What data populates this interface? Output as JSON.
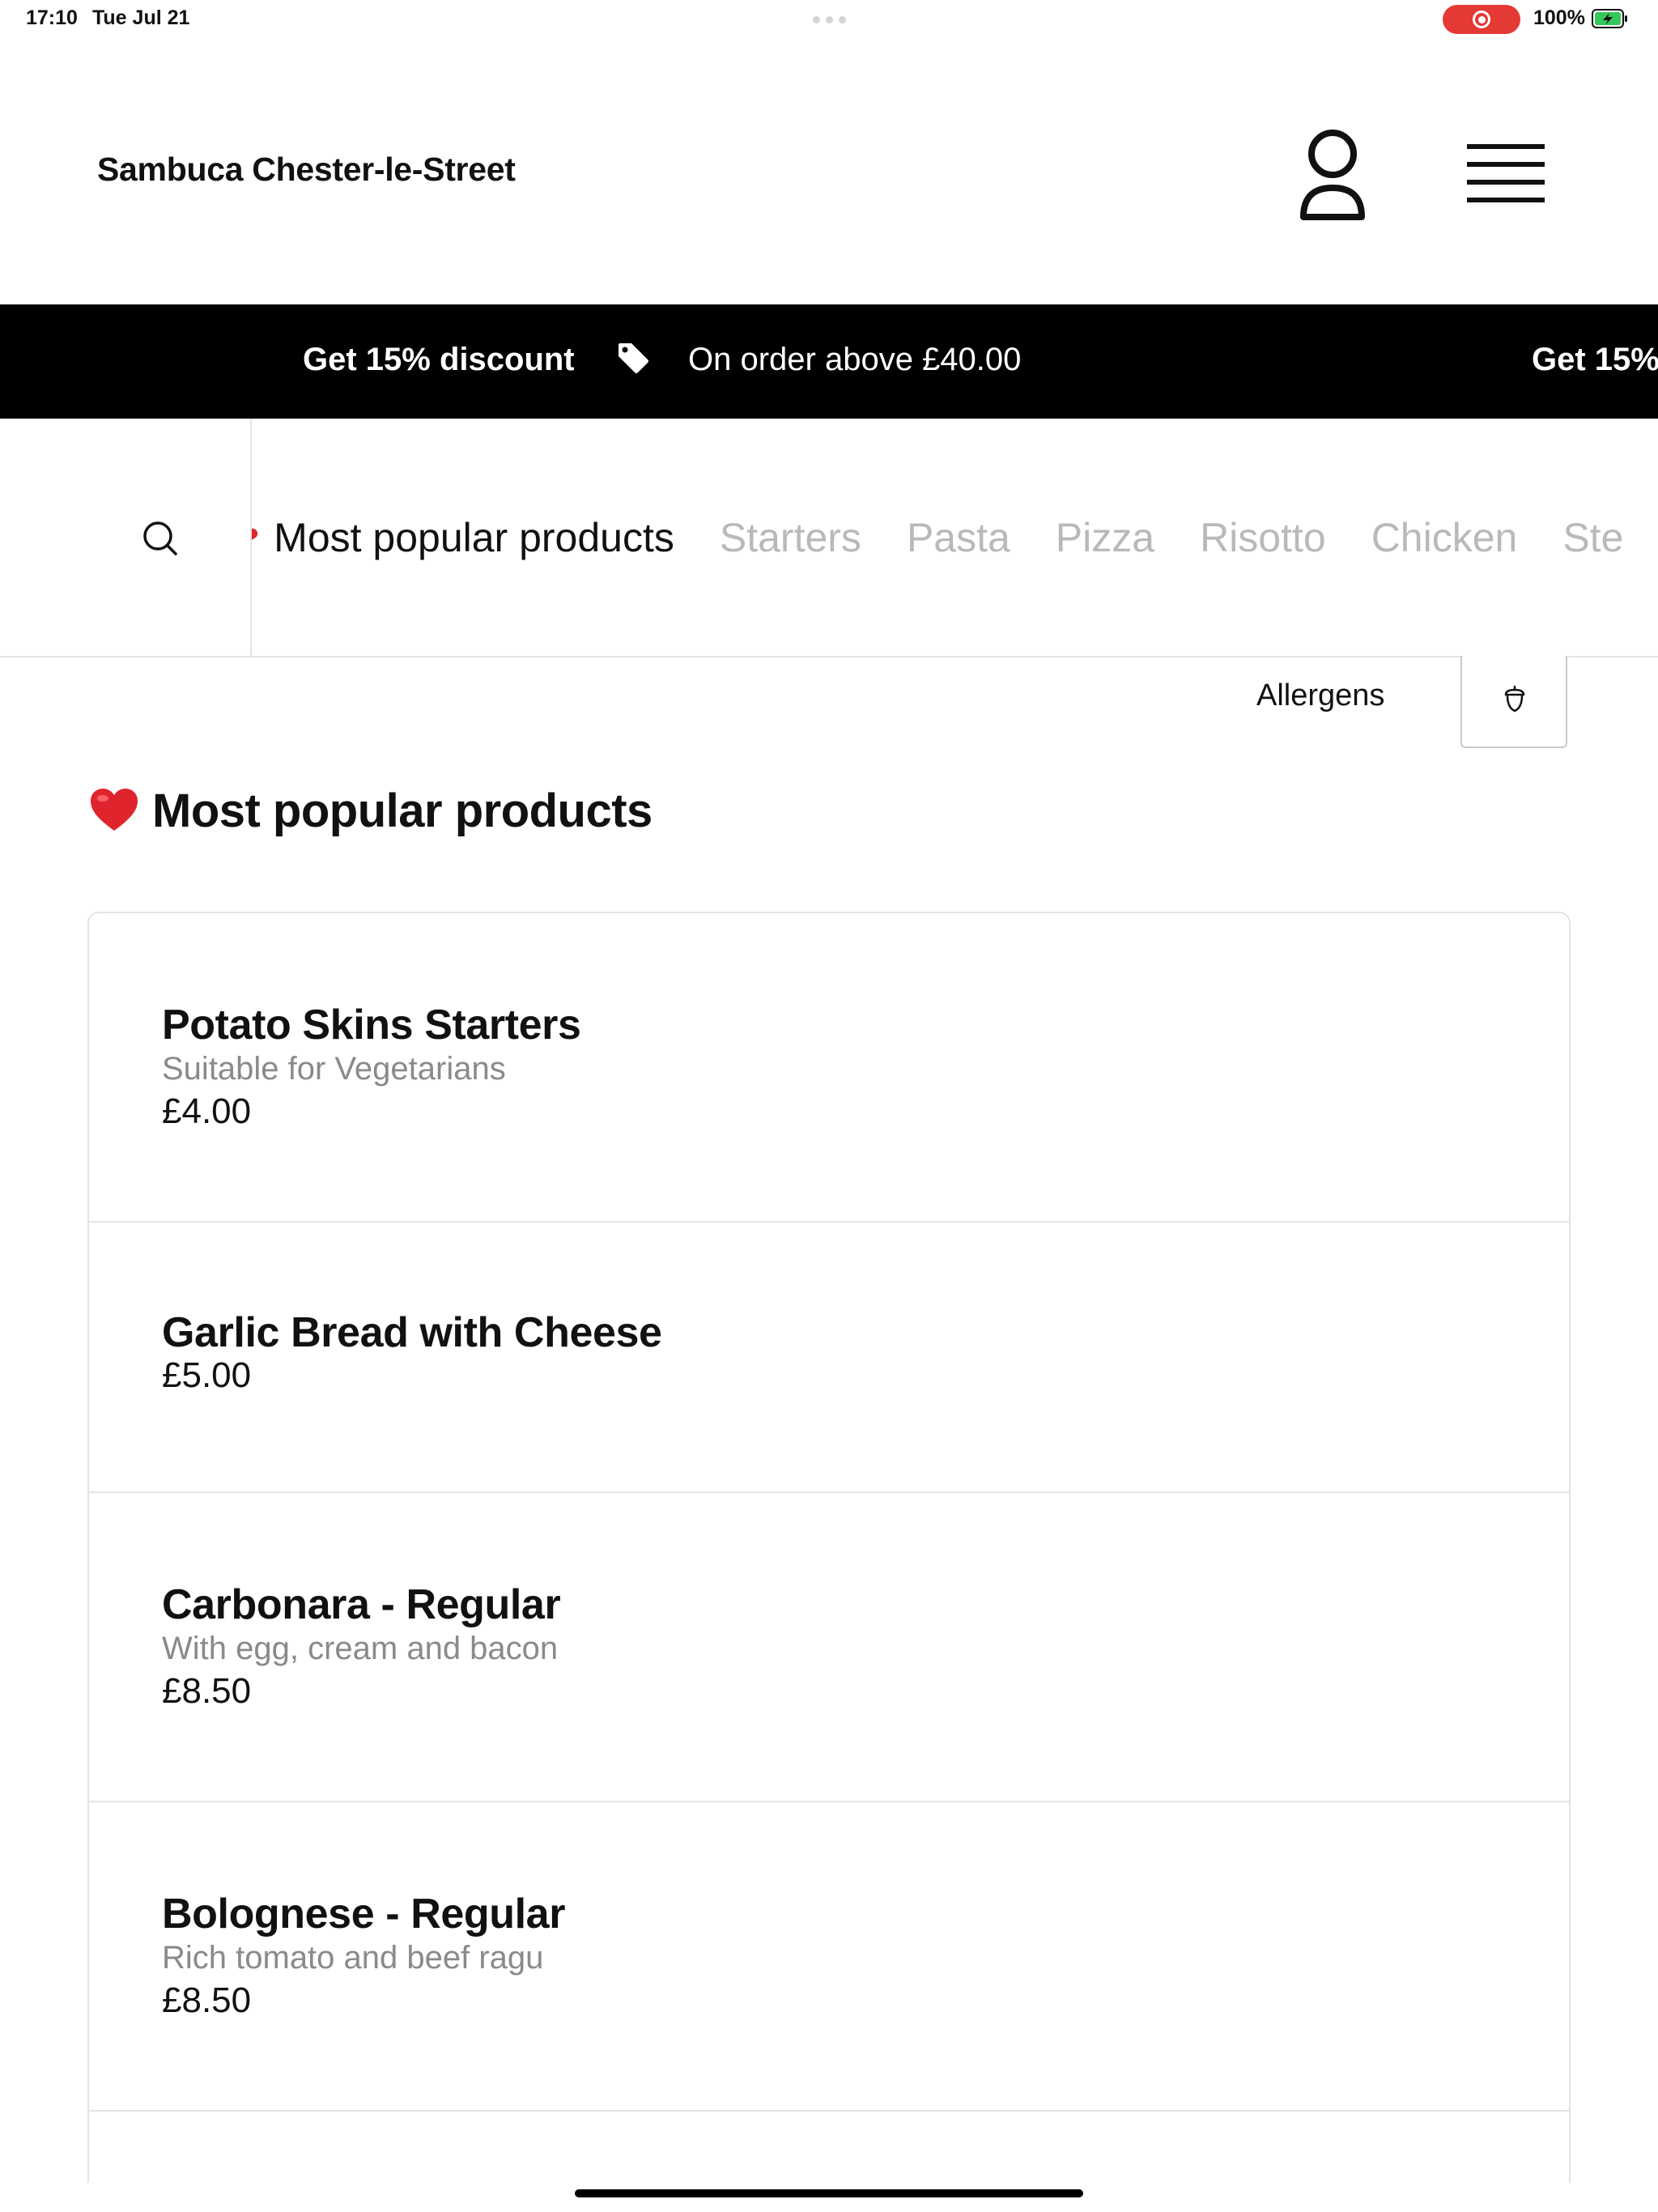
{
  "status_bar": {
    "time": "17:10",
    "date": "Tue Jul 21",
    "battery_percent": "100%",
    "battery_level": 1.0,
    "recording_color": "#e53935"
  },
  "header": {
    "store_name": "Sambuca Chester-le-Street",
    "account_icon": "person-outline-icon",
    "menu_icon": "hamburger-menu-icon"
  },
  "promo": {
    "title": "Get 15% discount",
    "tag_icon": "price-tag-icon",
    "text": "On order above £40.00",
    "title_repeat": "Get 15%"
  },
  "category_nav": {
    "search_icon": "search-icon",
    "tabs": [
      {
        "label": "Most popular products",
        "active": true
      },
      {
        "label": "Starters",
        "active": false
      },
      {
        "label": "Pasta",
        "active": false
      },
      {
        "label": "Pizza",
        "active": false
      },
      {
        "label": "Risotto",
        "active": false
      },
      {
        "label": "Chicken",
        "active": false
      },
      {
        "label": "Ste",
        "active": false
      }
    ]
  },
  "allergens": {
    "label": "Allergens",
    "icon": "acorn-icon"
  },
  "section": {
    "emoji": "heart-icon",
    "title": "Most popular products"
  },
  "products": [
    {
      "name": "Potato Skins Starters",
      "description": "Suitable for Vegetarians",
      "price": "£4.00"
    },
    {
      "name": "Garlic Bread with Cheese",
      "description": "",
      "price": "£5.00"
    },
    {
      "name": "Carbonara - Regular",
      "description": "With egg, cream and bacon",
      "price": "£8.50"
    },
    {
      "name": "Bolognese - Regular",
      "description": "Rich tomato and beef ragu",
      "price": "£8.50"
    }
  ],
  "colors": {
    "accent_red": "#e0242e",
    "banner_bg": "#000000",
    "muted_text": "#8a8a8a",
    "inactive_tab": "#b9b9b9"
  }
}
